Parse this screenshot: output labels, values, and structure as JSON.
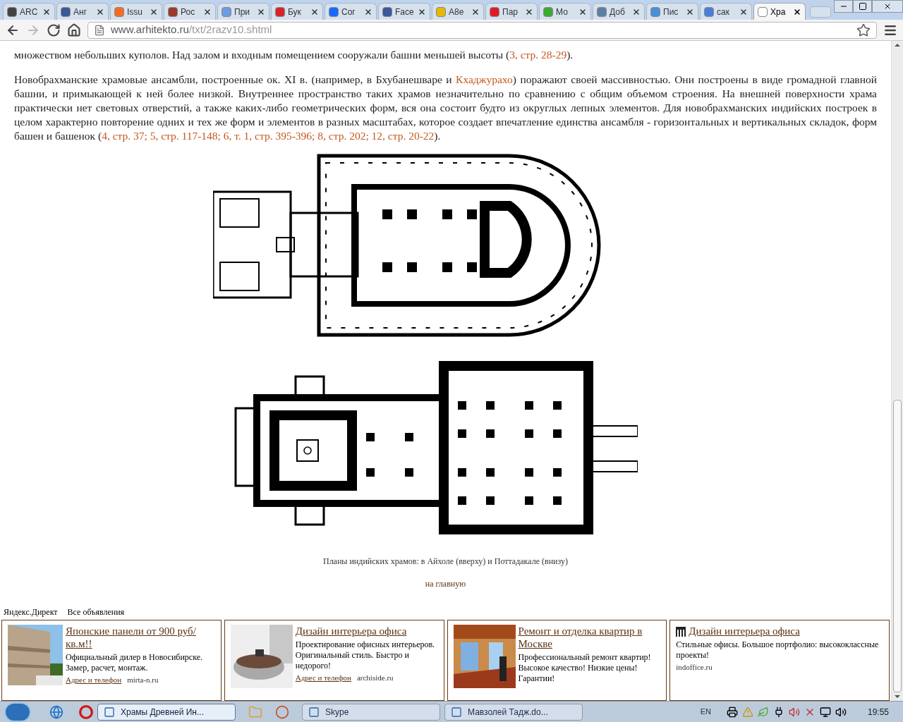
{
  "tabs": [
    {
      "label": "ARC",
      "selected": false,
      "color": "#444444"
    },
    {
      "label": "Анг",
      "selected": false,
      "color": "#3b5998"
    },
    {
      "label": "Issu",
      "selected": false,
      "color": "#f36d21"
    },
    {
      "label": "Рос",
      "selected": false,
      "color": "#9b3b2b"
    },
    {
      "label": "При",
      "selected": false,
      "color": "#6d9be0"
    },
    {
      "label": "Бук",
      "selected": false,
      "color": "#d8232a"
    },
    {
      "label": "Сог",
      "selected": false,
      "color": "#1769ff"
    },
    {
      "label": "Face",
      "selected": false,
      "color": "#3b5998"
    },
    {
      "label": "А8е",
      "selected": false,
      "color": "#e8b800"
    },
    {
      "label": "Пар",
      "selected": false,
      "color": "#e01b22"
    },
    {
      "label": "Мо",
      "selected": false,
      "color": "#3aaa35"
    },
    {
      "label": "Доб",
      "selected": false,
      "color": "#5b7fa6"
    },
    {
      "label": "Пис",
      "selected": false,
      "color": "#4a8fd8"
    },
    {
      "label": "сак",
      "selected": false,
      "color": "#4a7fd8"
    },
    {
      "label": "Хра",
      "selected": true,
      "color": "#ffffff"
    }
  ],
  "address": {
    "host": "www.arhitekto.ru",
    "path": "/txt/2razv10.shtml"
  },
  "article": {
    "paragraphs": [
      [
        {
          "text": "множеством небольших куполов. Над залом и входным помещением сооружали башни меньшей высоты (",
          "kind": "text"
        },
        {
          "text": "3, стр. 28-29",
          "kind": "link"
        },
        {
          "text": ").",
          "kind": "text"
        }
      ],
      [
        {
          "text": "Новобрахманские храмовые ансамбли, построенные ок. XI в. (например, в Бхубанешваре и ",
          "kind": "text"
        },
        {
          "text": "Кхаджурахо",
          "kind": "link"
        },
        {
          "text": ") поражают своей массивностью. Они построены в виде громадной главной башни, и примыкающей к ней более низкой. Внутреннее пространство таких храмов незначительно по сравнению с общим объемом строения. На внешней поверхности храма практически нет световых отверстий, а также каких-либо геометрических форм, вся она состоит будто из округлых лепных элементов. Для новобрахманских индийских построек в целом характерно повторение одних и тех же форм и элементов в разных масштабах, которое создает впечатление единства ансамбля - горизонтальных и вертикальных складок, форм башен и башенок (",
          "kind": "text"
        },
        {
          "text": "4, стр. 37; 5, стр. 117-148; 6, т. 1, стр. 395-396; 8, стр. 202; 12, стр. 20-22",
          "kind": "link"
        },
        {
          "text": ").",
          "kind": "text"
        }
      ]
    ],
    "caption": "Планы индийских храмов: в Айхоле (вверху) и Поттадакале (внизу)",
    "home_link": "на главную"
  },
  "ads": {
    "header": "Яндекс.Директ",
    "all_link": "Все объявления",
    "items": [
      {
        "kind": "picture",
        "title": "Японские панели от 900 руб/кв.м!!",
        "body": "Официальный дилер в Новосибирске. Замер, расчет, монтаж.",
        "contact": "Адрес и телефон",
        "domain": "mirta-n.ru"
      },
      {
        "kind": "picture",
        "title": "Дизайн интерьера офиса",
        "body": "Проектирование офисных интерьеров. Оригинальный стиль. Быстро и недорого!",
        "contact": "Адрес и телефон",
        "domain": "archiside.ru"
      },
      {
        "kind": "picture",
        "title": "Ремонт и отделка квартир в Москве",
        "body": "Профессиональный ремонт квартир! Высокое качество! Низкие цены! Гарантии!"
      },
      {
        "kind": "icon",
        "title": "Дизайн интерьера офиса",
        "body": "Стильные офисы. Большое портфолио: высококлассные проекты!",
        "domain": "indoffice.ru"
      }
    ]
  },
  "taskbar": {
    "tasks": [
      {
        "label": "Храмы Древней Ин...",
        "selected": true
      },
      {
        "label": "Skype",
        "selected": false
      },
      {
        "label": "Мавзолей Тадж.do...",
        "selected": false
      }
    ],
    "language": "EN",
    "clock": "19:55"
  }
}
